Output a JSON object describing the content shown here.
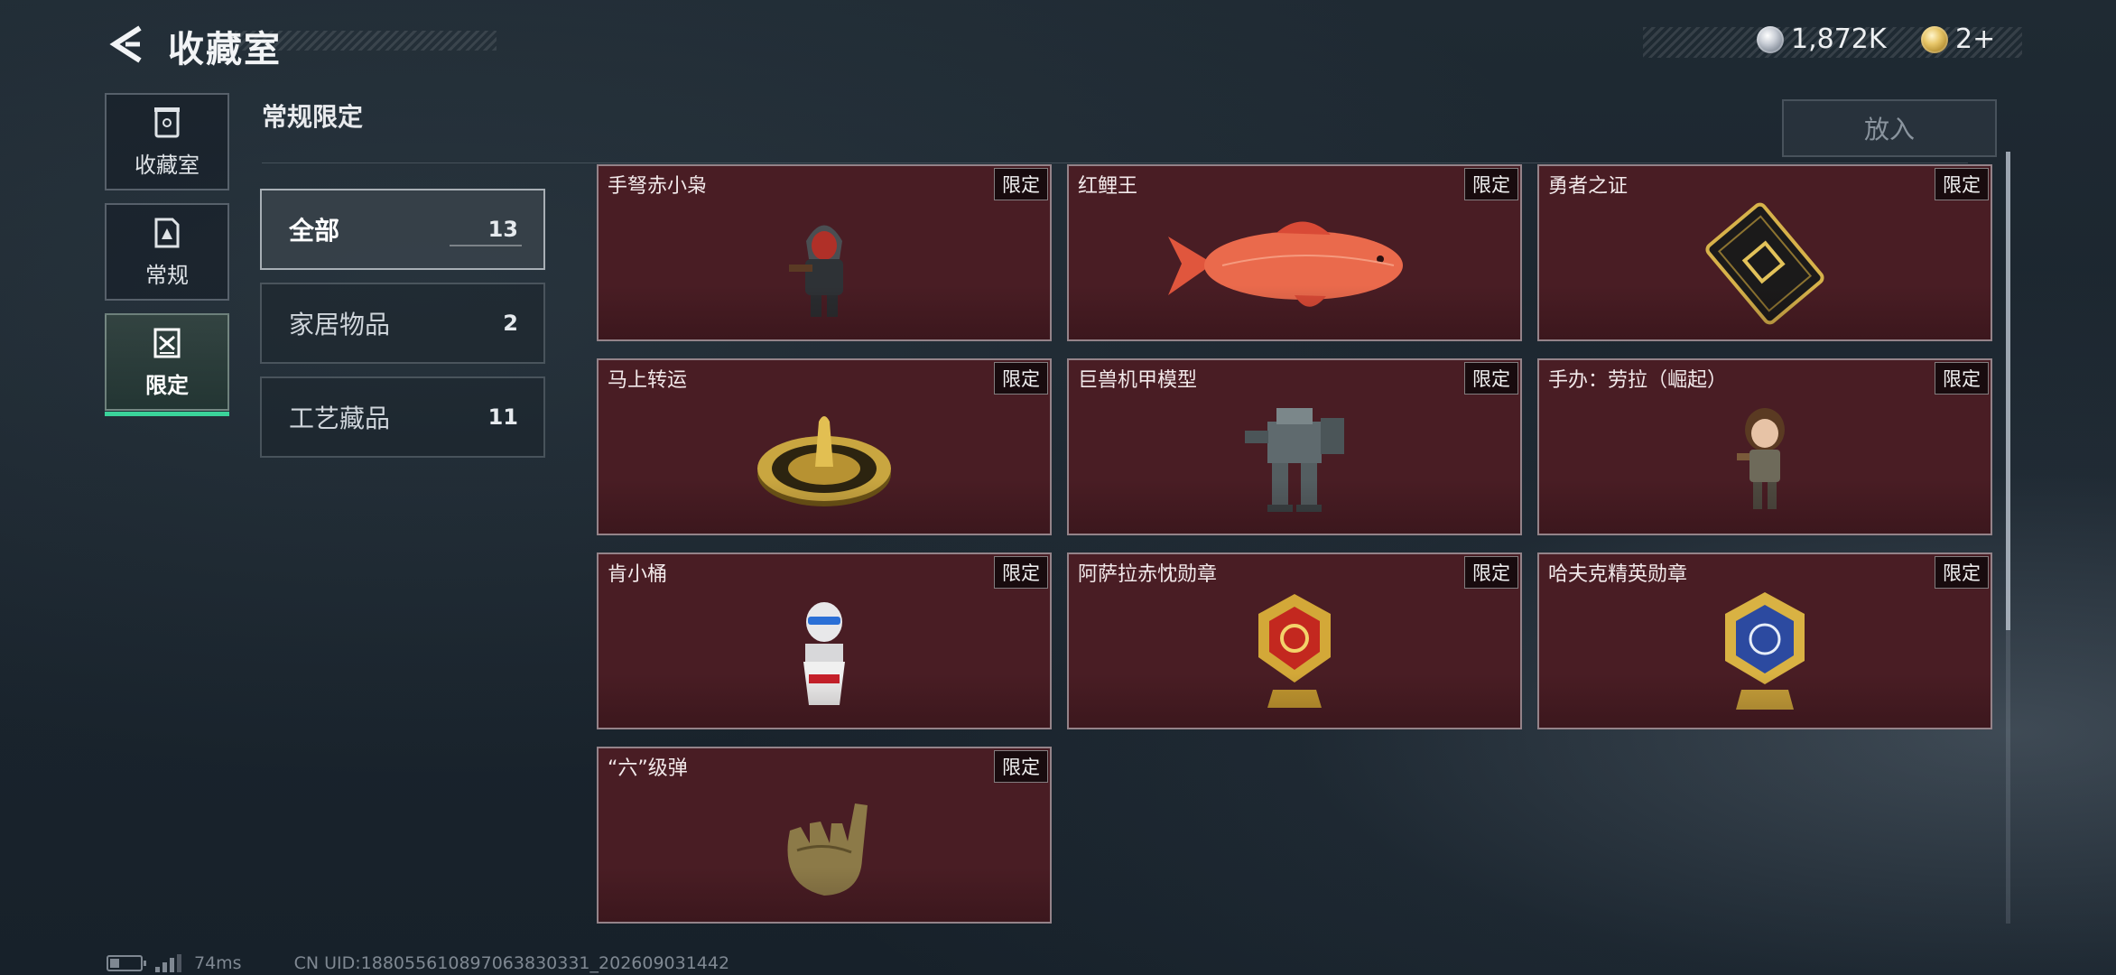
{
  "header": {
    "title": "收藏室"
  },
  "currency": [
    {
      "icon": "silver-coin-icon",
      "value": "1,872K"
    },
    {
      "icon": "gold-coin-icon",
      "value": "2+"
    }
  ],
  "nav": [
    {
      "label": "收藏室",
      "icon": "collection-room-icon",
      "active": false
    },
    {
      "label": "常规",
      "icon": "regular-icon",
      "active": false
    },
    {
      "label": "限定",
      "icon": "limited-icon",
      "active": true
    }
  ],
  "section": {
    "title": "常规限定"
  },
  "categories": [
    {
      "label": "全部",
      "count": "13",
      "active": true
    },
    {
      "label": "家居物品",
      "count": "2",
      "active": false
    },
    {
      "label": "工艺藏品",
      "count": "11",
      "active": false
    }
  ],
  "place_button": {
    "label": "放入"
  },
  "items": [
    {
      "name": "手弩赤小枭",
      "badge": "限定",
      "icon": "hooded-figurine-icon"
    },
    {
      "name": "红鲤王",
      "badge": "限定",
      "icon": "red-carp-icon"
    },
    {
      "name": "勇者之证",
      "badge": "限定",
      "icon": "brave-card-icon"
    },
    {
      "name": "马上转运",
      "badge": "限定",
      "icon": "gold-disc-icon"
    },
    {
      "name": "巨兽机甲模型",
      "badge": "限定",
      "icon": "mech-model-icon"
    },
    {
      "name": "手办：劳拉（崛起）",
      "badge": "限定",
      "icon": "lara-figurine-icon"
    },
    {
      "name": "肯小桶",
      "badge": "限定",
      "icon": "bucket-figurine-icon"
    },
    {
      "name": "阿萨拉赤忱勋章",
      "badge": "限定",
      "icon": "red-medal-icon"
    },
    {
      "name": "哈夫克精英勋章",
      "badge": "限定",
      "icon": "blue-medal-icon"
    },
    {
      "name": "“六”级弹",
      "badge": "限定",
      "icon": "golden-hand-icon"
    }
  ],
  "footer": {
    "ping": "74ms",
    "uid": "CN UID:188055610897063830331_202609031442"
  },
  "colors": {
    "card_bg": "#491d24",
    "accent_green": "#3ad39a",
    "badge_bg": "#0f080a"
  }
}
